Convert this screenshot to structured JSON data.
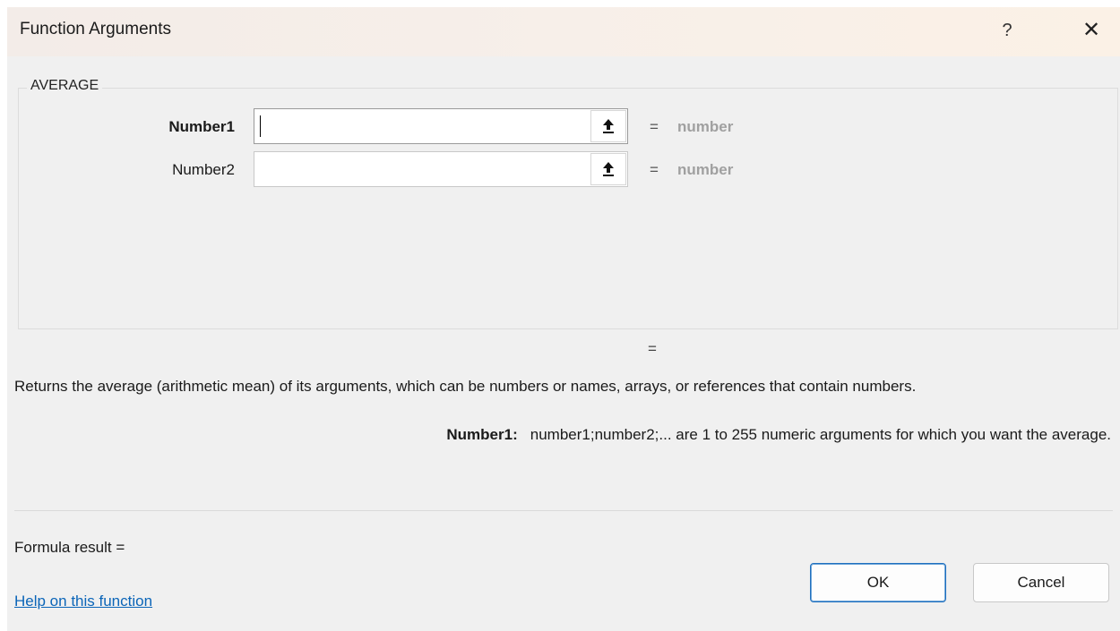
{
  "window": {
    "title": "Function Arguments",
    "help_glyph": "?",
    "close_glyph": "✕"
  },
  "function": {
    "name": "AVERAGE",
    "arguments": [
      {
        "label": "Number1",
        "value": "",
        "result_eq": "=",
        "result": "number"
      },
      {
        "label": "Number2",
        "value": "",
        "result_eq": "=",
        "result": "number"
      }
    ],
    "overall_eq": "=",
    "description": "Returns the average (arithmetic mean) of its arguments, which can be numbers or names, arrays, or references that contain numbers.",
    "arg_help": {
      "name": "Number1:",
      "text": "number1;number2;... are 1 to 255 numeric arguments for which you want the average."
    }
  },
  "footer": {
    "formula_result": "Formula result =",
    "help_link": "Help on this function",
    "ok_label": "OK",
    "cancel_label": "Cancel"
  },
  "icons": {
    "ref": "collapse-dialog-icon",
    "help": "help-icon",
    "close": "close-icon"
  },
  "colors": {
    "link": "#0b65b8",
    "ok_border": "#1f6fbf"
  }
}
